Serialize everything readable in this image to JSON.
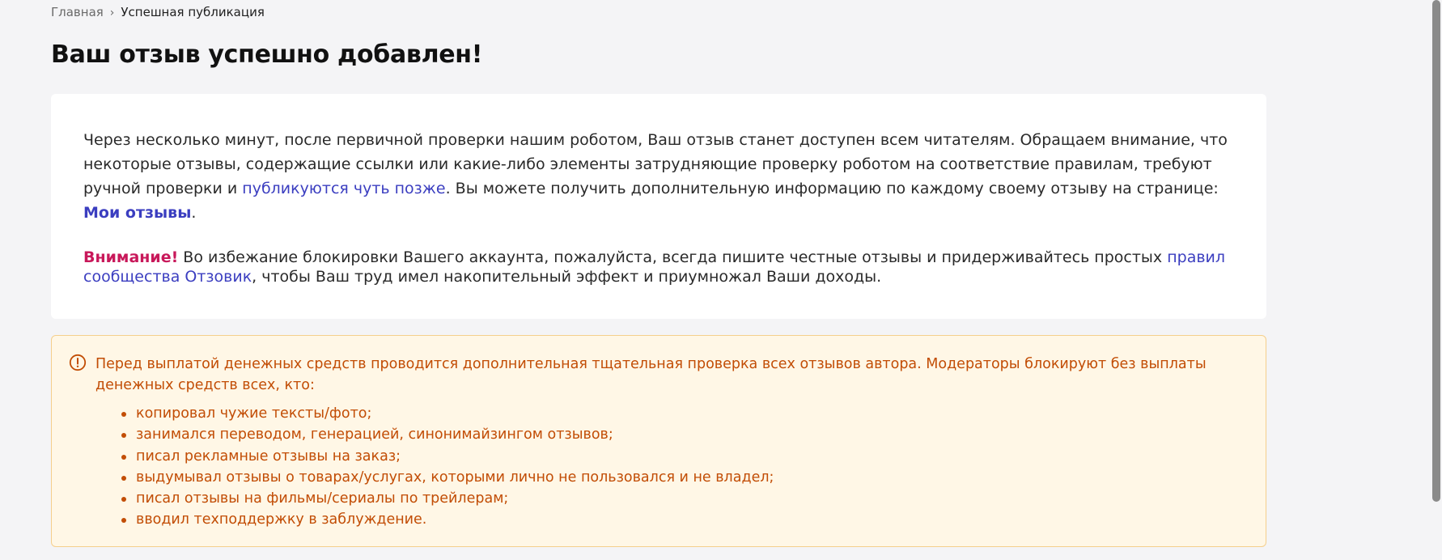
{
  "breadcrumb": {
    "home": "Главная",
    "separator": "›",
    "current": "Успешная публикация"
  },
  "title": "Ваш отзыв успешно добавлен!",
  "info": {
    "text_1": "Через несколько минут, после первичной проверки нашим роботом, Ваш отзыв станет доступен всем читателям. Обращаем внимание, что некоторые отзывы, содержащие ссылки или какие-либо элементы затрудняющие проверку роботом на соответствие правилам, требуют ручной проверки и ",
    "link_later": "публикуются чуть позже",
    "text_2": ". Вы можете получить дополнительную информацию по каждому своему отзыву на странице: ",
    "link_my_reviews": "Мои отзывы",
    "text_3": ".",
    "attention_label": "Внимание!",
    "warning_text_1": " Во избежание блокировки Вашего аккаунта, пожалуйста, всегда пишите честные отзывы и придерживайтесь простых ",
    "link_rules": "правил сообщества Отзовик",
    "warning_text_2": ", чтобы Ваш труд имел накопительный эффект и приумножал Ваши доходы."
  },
  "notice": {
    "icon": "exclamation-circle-icon",
    "text": "Перед выплатой денежных средств проводится дополнительная тщательная проверка всех отзывов автора. Модераторы блокируют без выплаты денежных средств всех, кто:",
    "items": [
      "копировал чужие тексты/фото;",
      "занимался переводом, генерацией, синонимайзингом отзывов;",
      "писал рекламные отзывы на заказ;",
      "выдумывал отзывы о товарах/услугах, которыми лично не пользовался и не владел;",
      "писал отзывы на фильмы/сериалы по трейлерам;",
      "вводил техподдержку в заблуждение."
    ]
  },
  "colors": {
    "background": "#f4f4f6",
    "link": "#3b3ec0",
    "attention": "#c8185a",
    "notice_text": "#c24d05",
    "notice_bg": "#fff7e6",
    "notice_border": "#f5cf8c"
  }
}
